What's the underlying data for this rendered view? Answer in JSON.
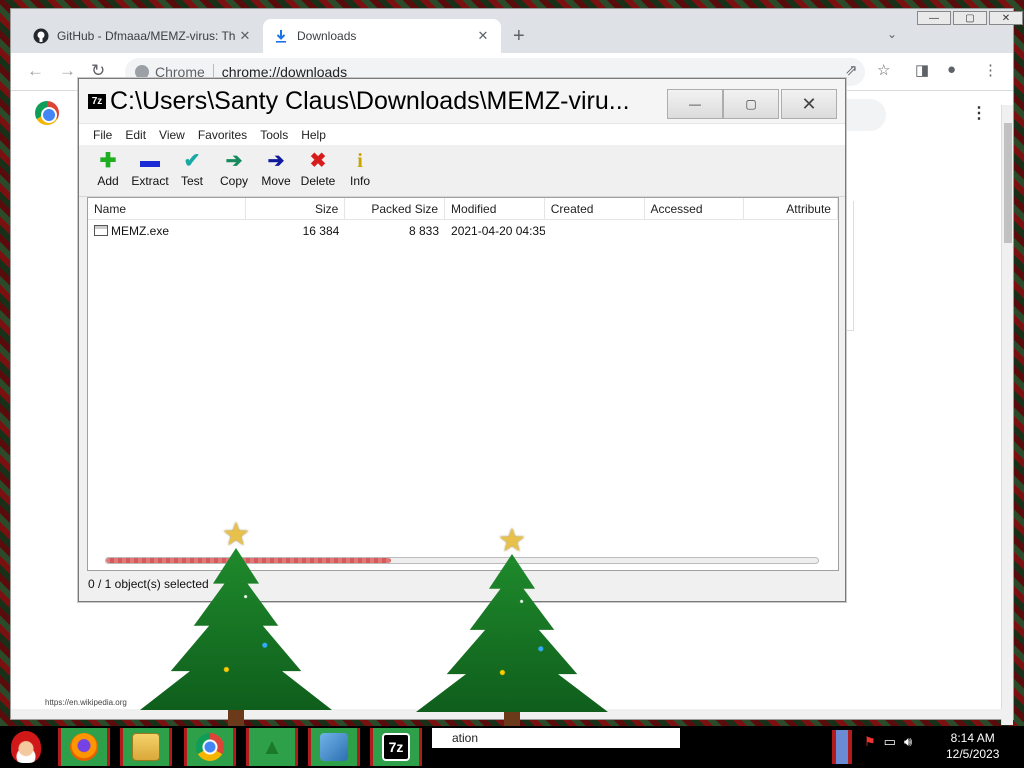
{
  "chrome": {
    "tabs": [
      {
        "title": "GitHub - Dfmaaa/MEMZ-virus: Th",
        "icon": "github-icon"
      },
      {
        "title": "Downloads",
        "icon": "download-icon"
      }
    ],
    "new_tab": "+",
    "site_label": "Chrome",
    "url": "chrome://downloads",
    "page_status_url": "https://en.wikipedia.org"
  },
  "zip": {
    "title": "C:\\Users\\Santy Claus\\Downloads\\MEMZ-viru...",
    "menu": [
      "File",
      "Edit",
      "View",
      "Favorites",
      "Tools",
      "Help"
    ],
    "toolbar": [
      {
        "label": "Add",
        "icon": "add-icon",
        "glyph": "✚",
        "color": "#1fae1f"
      },
      {
        "label": "Extract",
        "icon": "extract-icon",
        "glyph": "▬",
        "color": "#1a2ad4"
      },
      {
        "label": "Test",
        "icon": "test-icon",
        "glyph": "✔",
        "color": "#19a9a4"
      },
      {
        "label": "Copy",
        "icon": "copy-icon",
        "glyph": "➔",
        "color": "#168a5e"
      },
      {
        "label": "Move",
        "icon": "move-icon",
        "glyph": "➔",
        "color": "#101a9c"
      },
      {
        "label": "Delete",
        "icon": "delete-icon",
        "glyph": "✖",
        "color": "#d81c1c"
      },
      {
        "label": "Info",
        "icon": "info-icon",
        "glyph": "i",
        "color": "#c9a400"
      }
    ],
    "columns": [
      "Name",
      "Size",
      "Packed Size",
      "Modified",
      "Created",
      "Accessed",
      "Attribute"
    ],
    "rows": [
      {
        "name": "MEMZ.exe",
        "size": "16 384",
        "packed": "8 833",
        "modified": "2021-04-20 04:35",
        "created": "",
        "accessed": "",
        "attr": ""
      }
    ],
    "progress": 0.4,
    "status": "0 / 1 object(s) selected"
  },
  "taskbar": {
    "apps": [
      {
        "name": "firefox",
        "icon": "firefox-icon",
        "color": "#e66000",
        "glyph": "●"
      },
      {
        "name": "explorer",
        "icon": "folder-icon",
        "color": "#e2b53c",
        "glyph": "▤"
      },
      {
        "name": "chrome",
        "icon": "chrome-icon",
        "color": "#4285f4",
        "glyph": "◉"
      },
      {
        "name": "tree",
        "icon": "christmas-tree-icon",
        "color": "#1a7a2a",
        "glyph": "▲"
      },
      {
        "name": "control-panel",
        "icon": "control-panel-icon",
        "color": "#3f86c9",
        "glyph": "▦"
      },
      {
        "name": "7zip",
        "icon": "7zip-icon",
        "color": "#000000",
        "glyph": "7z"
      }
    ],
    "window_label": "ation",
    "time": "8:14 AM",
    "date": "12/5/2023"
  }
}
